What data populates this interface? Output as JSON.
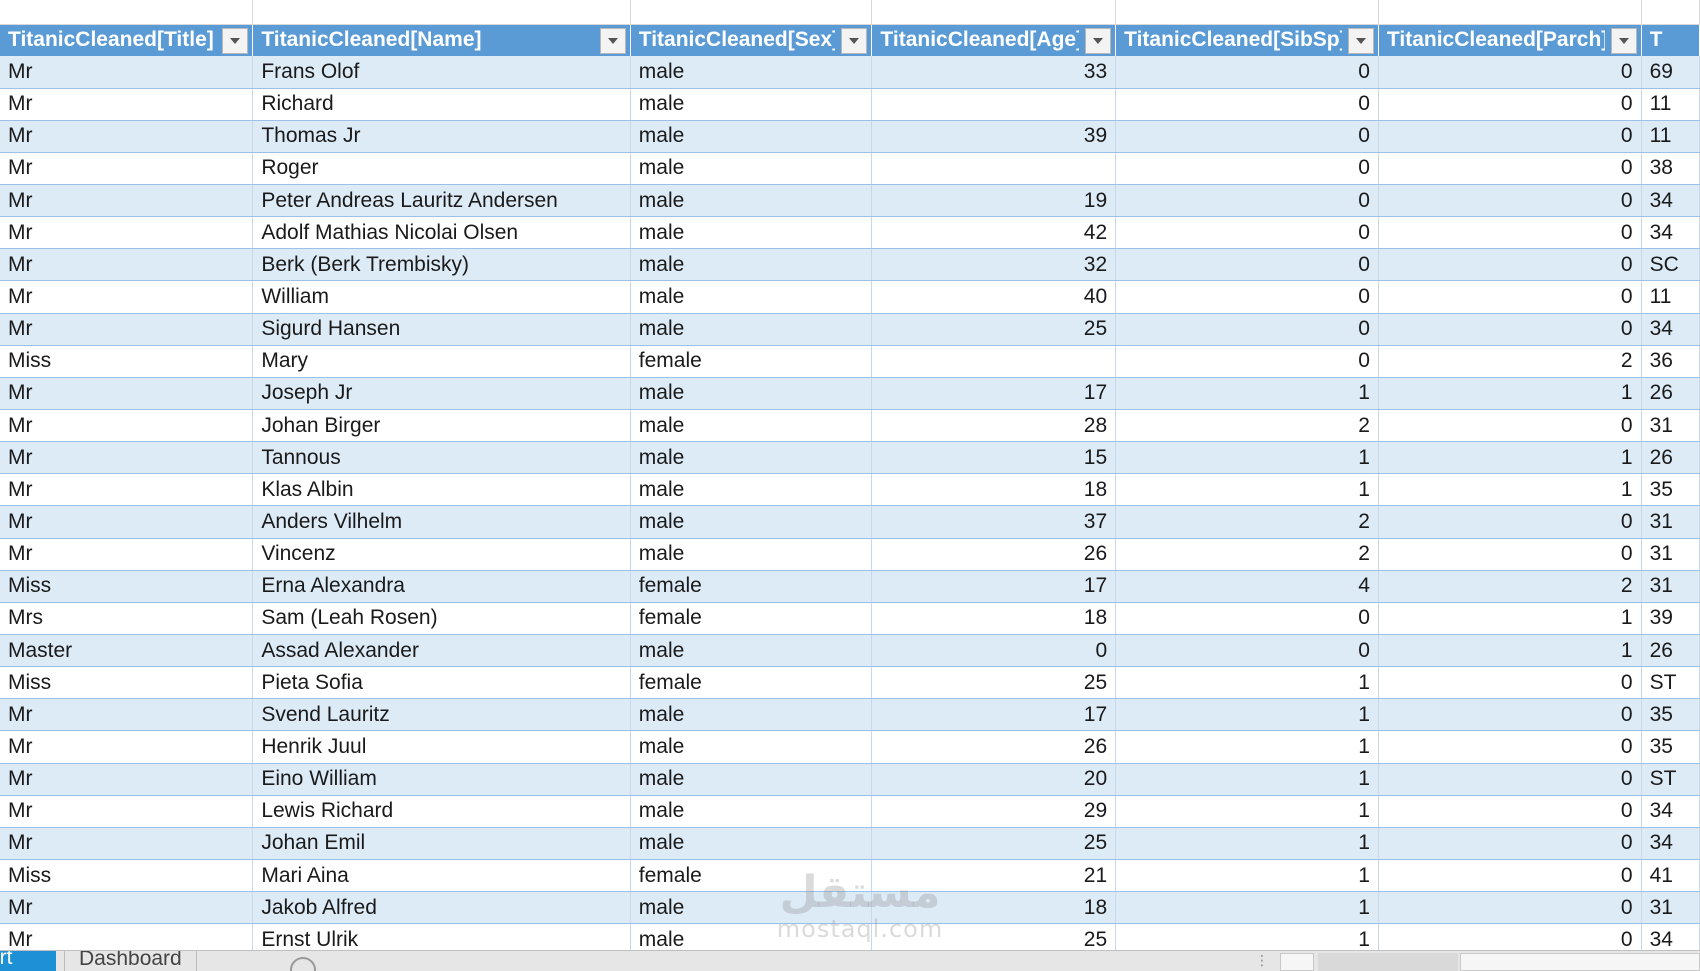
{
  "headers": [
    "TitanicCleaned[Title]",
    "TitanicCleaned[Name]",
    "TitanicCleaned[Sex]",
    "TitanicCleaned[Age]",
    "TitanicCleaned[SibSp]",
    "TitanicCleaned[Parch]",
    "Tit"
  ],
  "rows": [
    [
      "Mr",
      "Frans Olof",
      "male",
      "33",
      "0",
      "0",
      "69"
    ],
    [
      "Mr",
      "Richard",
      "male",
      "",
      "0",
      "0",
      "11"
    ],
    [
      "Mr",
      "Thomas Jr",
      "male",
      "39",
      "0",
      "0",
      "11"
    ],
    [
      "Mr",
      "Roger",
      "male",
      "",
      "0",
      "0",
      "38"
    ],
    [
      "Mr",
      "Peter Andreas Lauritz Andersen",
      "male",
      "19",
      "0",
      "0",
      "34"
    ],
    [
      "Mr",
      "Adolf Mathias Nicolai Olsen",
      "male",
      "42",
      "0",
      "0",
      "34"
    ],
    [
      "Mr",
      "Berk (Berk Trembisky)",
      "male",
      "32",
      "0",
      "0",
      "SC"
    ],
    [
      "Mr",
      "William",
      "male",
      "40",
      "0",
      "0",
      "11"
    ],
    [
      "Mr",
      "Sigurd Hansen",
      "male",
      "25",
      "0",
      "0",
      "34"
    ],
    [
      "Miss",
      "Mary",
      "female",
      "",
      "0",
      "2",
      "36"
    ],
    [
      "Mr",
      "Joseph Jr",
      "male",
      "17",
      "1",
      "1",
      "26"
    ],
    [
      "Mr",
      "Johan Birger",
      "male",
      "28",
      "2",
      "0",
      "31"
    ],
    [
      "Mr",
      "Tannous",
      "male",
      "15",
      "1",
      "1",
      "26"
    ],
    [
      "Mr",
      "Klas Albin",
      "male",
      "18",
      "1",
      "1",
      "35"
    ],
    [
      "Mr",
      "Anders Vilhelm",
      "male",
      "37",
      "2",
      "0",
      "31"
    ],
    [
      "Mr",
      "Vincenz",
      "male",
      "26",
      "2",
      "0",
      "31"
    ],
    [
      "Miss",
      "Erna Alexandra",
      "female",
      "17",
      "4",
      "2",
      "31"
    ],
    [
      "Mrs",
      "Sam (Leah Rosen)",
      "female",
      "18",
      "0",
      "1",
      "39"
    ],
    [
      "Master",
      "Assad Alexander",
      "male",
      "0",
      "0",
      "1",
      "26"
    ],
    [
      "Miss",
      "Pieta Sofia",
      "female",
      "25",
      "1",
      "0",
      "ST"
    ],
    [
      "Mr",
      "Svend Lauritz",
      "male",
      "17",
      "1",
      "0",
      "35"
    ],
    [
      "Mr",
      "Henrik Juul",
      "male",
      "26",
      "1",
      "0",
      "35"
    ],
    [
      "Mr",
      "Eino William",
      "male",
      "20",
      "1",
      "0",
      "ST"
    ],
    [
      "Mr",
      "Lewis Richard",
      "male",
      "29",
      "1",
      "0",
      "34"
    ],
    [
      "Mr",
      "Johan Emil",
      "male",
      "25",
      "1",
      "0",
      "34"
    ],
    [
      "Miss",
      "Mari Aina",
      "female",
      "21",
      "1",
      "0",
      "41"
    ],
    [
      "Mr",
      "Jakob Alfred",
      "male",
      "18",
      "1",
      "0",
      "31"
    ],
    [
      "Mr",
      "Ernst Ulrik",
      "male",
      "25",
      "1",
      "0",
      "34"
    ]
  ],
  "tabs": {
    "active": "ort",
    "dashboard": "Dashboard"
  },
  "watermark": {
    "arabic": "مستقل",
    "latin": "mostaql.com"
  },
  "colors": {
    "header_bg": "#5b9bd5",
    "band_bg": "#ddebf7",
    "active_tab": "#1e90d6"
  },
  "icons": {
    "filter": "chevron-down-icon",
    "add_sheet": "plus-circle-icon"
  }
}
